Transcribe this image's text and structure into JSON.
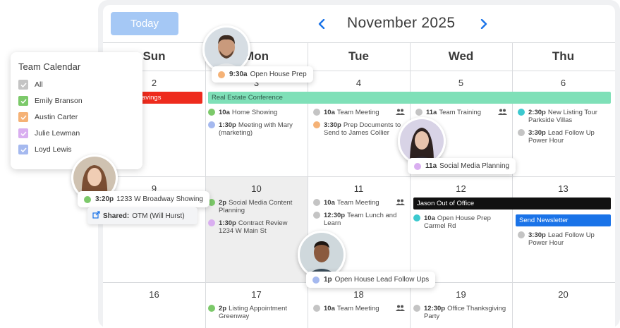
{
  "toolbar": {
    "today_label": "Today",
    "month_label": "November 2025"
  },
  "day_names": [
    "Sun",
    "Mon",
    "Tue",
    "Wed",
    "Thu"
  ],
  "weeks": [
    [
      "2",
      "3",
      "4",
      "5",
      "6"
    ],
    [
      "9",
      "10",
      "11",
      "12",
      "13"
    ],
    [
      "16",
      "17",
      "18",
      "19",
      "20"
    ]
  ],
  "bars": {
    "savings": "avings",
    "conference": "Real Estate Conference",
    "out_of_office": "Jason Out of Office",
    "newsletter": "Send Newsletter"
  },
  "events": {
    "mon3_a": {
      "time": "10a",
      "title": "Home Showing"
    },
    "mon3_b": {
      "time": "1:30p",
      "title": "Meeting with Mary",
      "title2": "(marketing)"
    },
    "tue4_a": {
      "time": "10a",
      "title": "Team Meeting"
    },
    "tue4_b": {
      "time": "3:30p",
      "title": "Prep Documents to",
      "title2": "Send to James Collier"
    },
    "wed5_a": {
      "time": "11a",
      "title": "Team Training"
    },
    "thu6_a": {
      "time": "2:30p",
      "title": "New Listing Tour",
      "title2": "Parkside Villas"
    },
    "thu6_b": {
      "time": "3:30p",
      "title": "Lead Follow Up",
      "title2": "Power Hour"
    },
    "mon10_a": {
      "time": "2p",
      "title": "Social Media Content",
      "title2": "Planning"
    },
    "mon10_b": {
      "time": "1:30p",
      "title": "Contract Review",
      "title2": "1234 W Main St"
    },
    "tue11_a": {
      "time": "10a",
      "title": "Team Meeting"
    },
    "tue11_b": {
      "time": "12:30p",
      "title": "Team Lunch and",
      "title2": "Learn"
    },
    "wed12_a": {
      "time": "10a",
      "title": "Open House Prep",
      "title2": "Carmel Rd"
    },
    "thu13_a": {
      "time": "3:30p",
      "title": "Lead Follow Up",
      "title2": "Power Hour"
    },
    "mon17_a": {
      "time": "2p",
      "title": "Listing Appointment",
      "title2": "Greenway"
    },
    "tue18_a": {
      "time": "10a",
      "title": "Team Meeting"
    },
    "wed19_a": {
      "time": "12:30p",
      "title": "Office Thanksgiving",
      "title2": "Party"
    }
  },
  "team_panel": {
    "title": "Team Calendar",
    "members": [
      "All",
      "Emily Branson",
      "Austin Carter",
      "Julie Lewman",
      "Loyd Lewis"
    ]
  },
  "popups": {
    "open_house_prep": {
      "time": "9:30a",
      "title": "Open House Prep"
    },
    "social_media": {
      "time": "11a",
      "title": "Social Media Planning"
    },
    "broadway": {
      "time": "3:20p",
      "title": "1233 W Broadway Showing"
    },
    "lead_follow_ups": {
      "time": "1p",
      "title": "Open House Lead Follow Ups"
    },
    "shared": {
      "label": "Shared:",
      "value": "OTM (Will Hurst)"
    }
  },
  "colors": {
    "green": "#7cc96a",
    "gray": "#c4c4c4",
    "orange": "#f5b276",
    "purple": "#d9aef0",
    "blue": "#a5b9ef",
    "teal": "#3cc9cf",
    "mint": "#7fe0b8",
    "red": "#ee2b1d",
    "black": "#111111",
    "brand_blue": "#1a73e8"
  }
}
